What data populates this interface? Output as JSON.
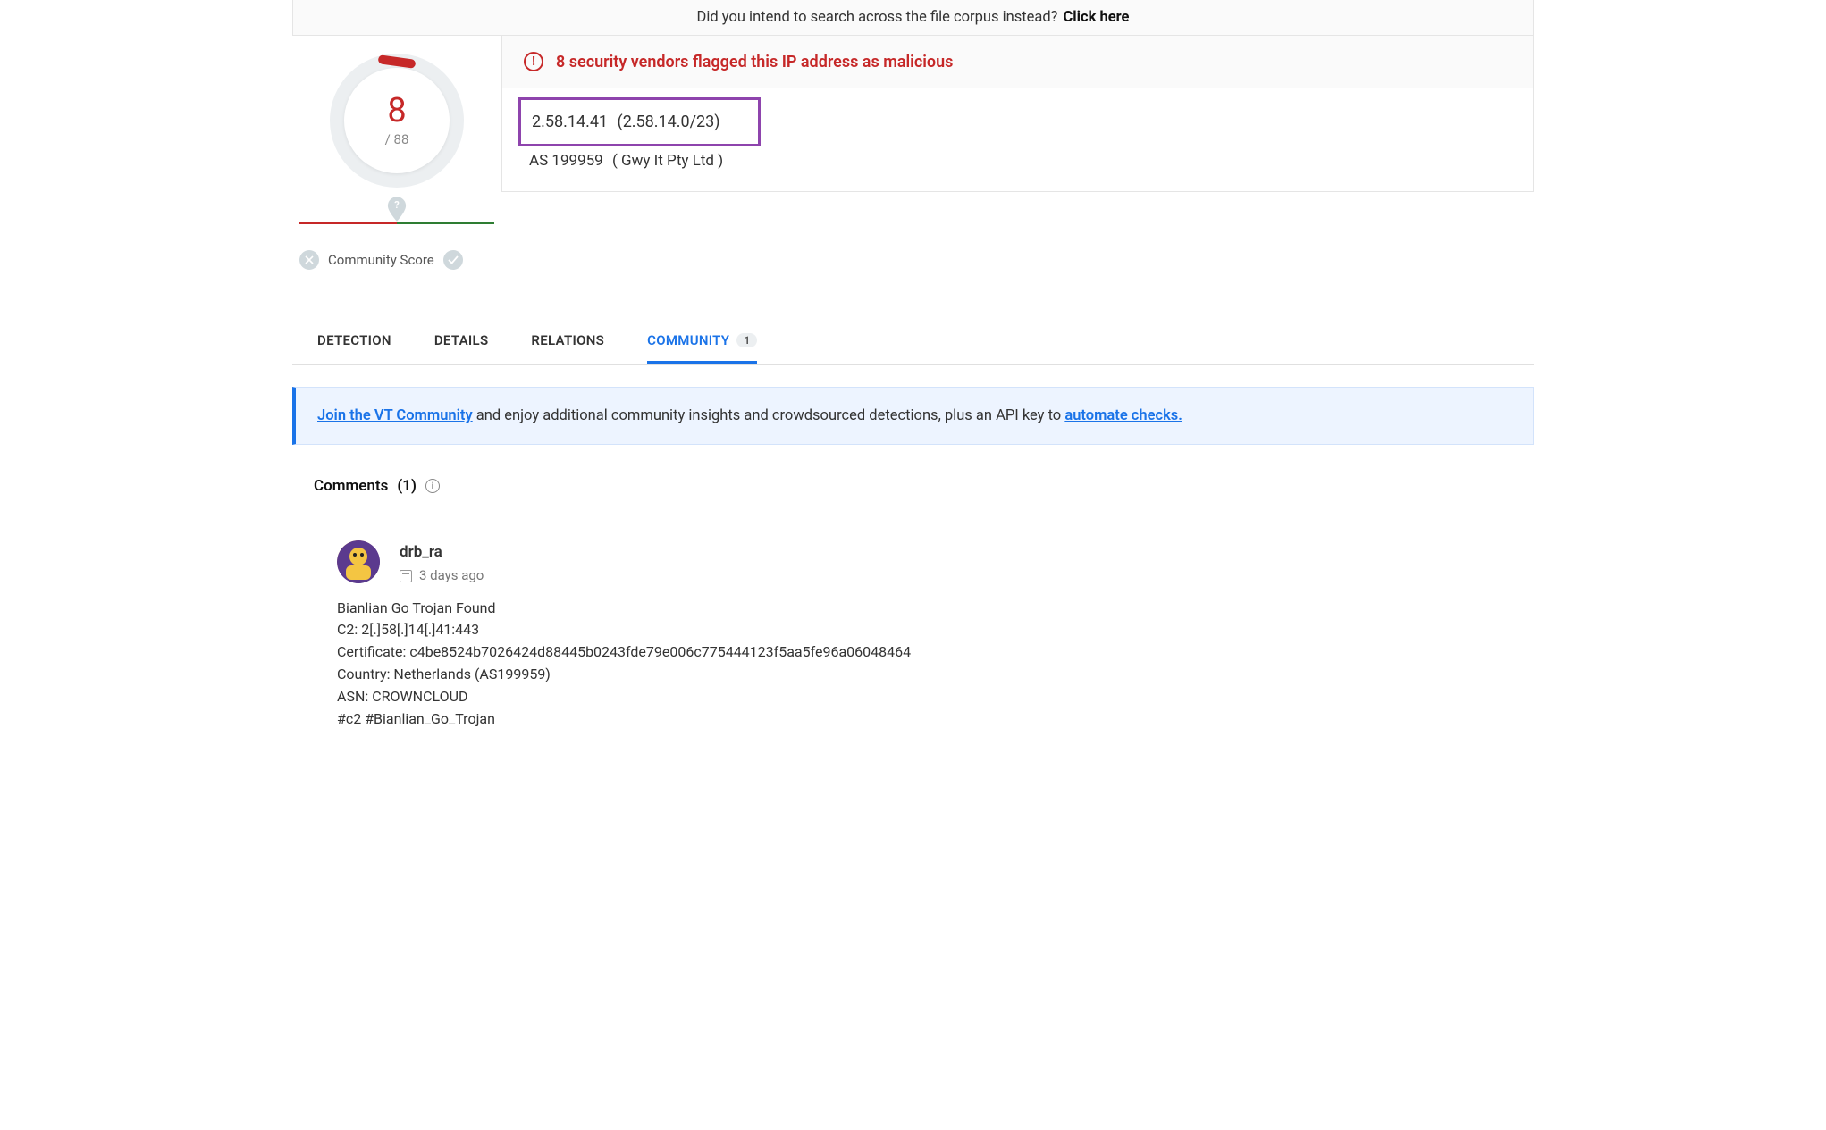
{
  "top_prompt": {
    "text": "Did you intend to search across the file corpus instead?",
    "link": "Click here"
  },
  "score": {
    "value": "8",
    "total": "/ 88"
  },
  "community_score": {
    "label": "Community Score"
  },
  "flag": {
    "text": "8 security vendors flagged this IP address as malicious"
  },
  "ip": {
    "address": "2.58.14.41",
    "range": "(2.58.14.0/23)",
    "asn": "AS 199959",
    "as_name": "( Gwy It Pty Ltd )"
  },
  "tabs": {
    "detection": "DETECTION",
    "details": "DETAILS",
    "relations": "RELATIONS",
    "community": "COMMUNITY",
    "community_badge": "1"
  },
  "join_banner": {
    "link1": "Join the VT Community",
    "mid": " and enjoy additional community insights and crowdsourced detections, plus an API key to ",
    "link2": "automate checks."
  },
  "comments": {
    "header": "Comments",
    "count": "(1)"
  },
  "comment": {
    "author": "drb_ra",
    "time": "3 days ago",
    "l1": "Bianlian Go Trojan Found",
    "l2": "C2: 2[.]58[.]14[.]41:443",
    "l3": "Certificate: c4be8524b7026424d88445b0243fde79e006c775444123f5aa5fe96a06048464",
    "l4": "Country: Netherlands (AS199959)",
    "l5": "ASN: CROWNCLOUD",
    "l6": "#c2 #Bianlian_Go_Trojan"
  }
}
